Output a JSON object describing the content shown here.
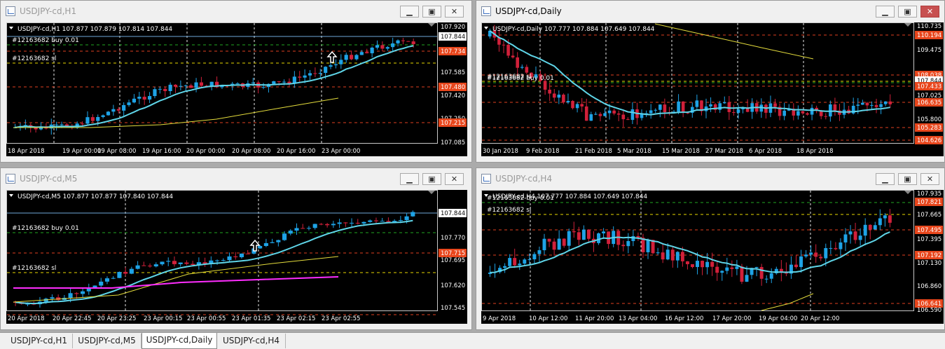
{
  "windows": {
    "h1": {
      "title": "USDJPY-cd,H1",
      "header": "USDJPY-cd,H1  107.877 107.879 107.814 107.844",
      "lines": {
        "buy": "#12163682 buy 0.01",
        "sl": "#12163682 sl"
      },
      "price_labels": [
        "107.920",
        "107.844",
        "107.734",
        "107.585",
        "107.480",
        "107.420",
        "107.250",
        "107.215",
        "107.085"
      ],
      "time_labels": [
        "18 Apr 2018",
        "19 Apr 00:00",
        "19 Apr 08:00",
        "19 Apr 16:00",
        "20 Apr 00:00",
        "20 Apr 08:00",
        "20 Apr 16:00",
        "23 Apr 00:00"
      ]
    },
    "daily": {
      "title": "USDJPY-cd,Daily",
      "header": "USDJPY-cd,Daily  107.777 107.884 107.649 107.844",
      "lines": {
        "buy": "#12163682 buy 0.01",
        "sl": "#12163682 sl"
      },
      "price_labels": [
        "110.735",
        "110.194",
        "109.475",
        "108.038",
        "107.844",
        "107.433",
        "107.025",
        "106.635",
        "105.800",
        "105.283",
        "104.626"
      ],
      "time_labels": [
        "30 Jan 2018",
        "9 Feb 2018",
        "21 Feb 2018",
        "5 Mar 2018",
        "15 Mar 2018",
        "27 Mar 2018",
        "6 Apr 2018",
        "18 Apr 2018"
      ]
    },
    "m5": {
      "title": "USDJPY-cd,M5",
      "header": "USDJPY-cd,M5  107.877 107.877 107.840 107.844",
      "lines": {
        "buy": "#12163682 buy 0.01",
        "sl": "#12163682 sl"
      },
      "price_labels": [
        "107.844",
        "107.770",
        "107.715",
        "107.695",
        "107.620",
        "107.545"
      ],
      "time_labels": [
        "20 Apr 2018",
        "20 Apr 22:45",
        "20 Apr 23:25",
        "23 Apr 00:15",
        "23 Apr 00:55",
        "23 Apr 01:35",
        "23 Apr 02:15",
        "23 Apr 02:55"
      ]
    },
    "h4": {
      "title": "USDJPY-cd,H4",
      "header": "USDJPY-cd,H4  107.777 107.884 107.649 107.844",
      "lines": {
        "buy": "#12163682 buy 0.01",
        "sl": "#12163682 sl"
      },
      "price_labels": [
        "107.935",
        "107.821",
        "107.665",
        "107.495",
        "107.395",
        "107.192",
        "107.130",
        "106.860",
        "106.641",
        "106.590"
      ],
      "time_labels": [
        "9 Apr 2018",
        "10 Apr 12:00",
        "11 Apr 20:00",
        "13 Apr 04:00",
        "16 Apr 12:00",
        "17 Apr 20:00",
        "19 Apr 04:00",
        "20 Apr 12:00"
      ]
    }
  },
  "window_buttons": {
    "minimize": "▁",
    "maximize": "▣",
    "close": "✕"
  },
  "tabs": [
    {
      "label": "USDJPY-cd,H1",
      "active": false
    },
    {
      "label": "USDJPY-cd,M5",
      "active": false
    },
    {
      "label": "USDJPY-cd,Daily",
      "active": true
    },
    {
      "label": "USDJPY-cd,H4",
      "active": false
    }
  ],
  "colors": {
    "bull": "#1ea3e6",
    "bear": "#d1203a",
    "ma_fast": "#5fd5e8",
    "ma_slow": "#e4dc3c",
    "ma_m5": "#ff2dff",
    "buy_line": "#22a822",
    "sl_line": "#e8d800",
    "level": "#e04020",
    "label_red": "#e8461c"
  }
}
